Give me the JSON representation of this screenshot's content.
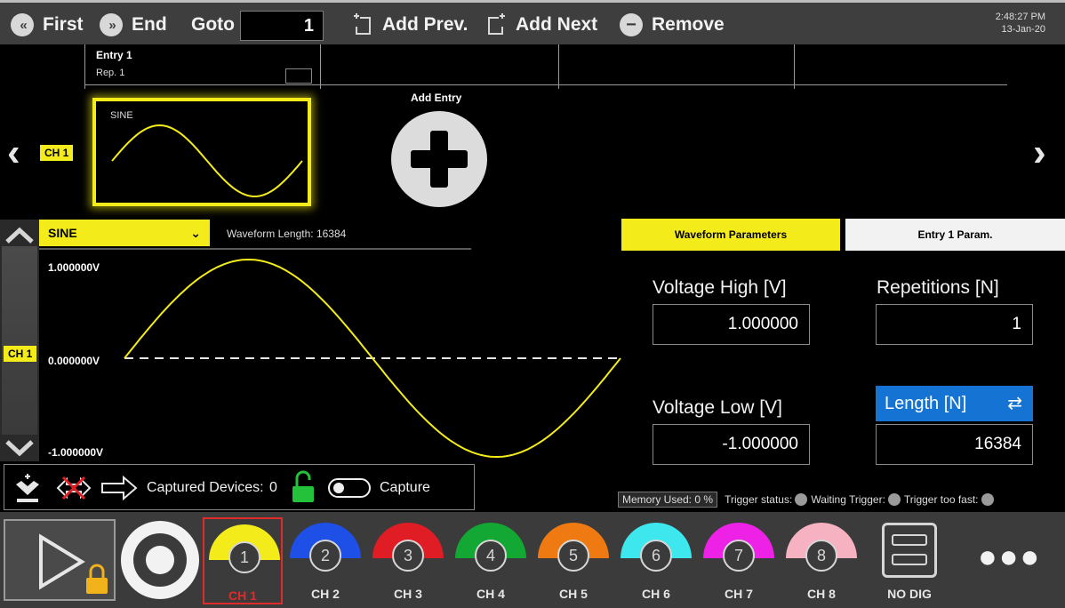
{
  "toolbar": {
    "first_label": "First",
    "end_label": "End",
    "goto_label": "Goto",
    "goto_value": "1",
    "add_prev_label": "Add Prev.",
    "add_next_label": "Add Next",
    "remove_label": "Remove",
    "clock_time": "2:48:27 PM",
    "clock_date": "13-Jan-20"
  },
  "sequence": {
    "entry_title": "Entry  1",
    "entry_rep": "Rep.  1",
    "card_label": "SINE",
    "channel_badge": "CH 1",
    "add_entry_label": "Add Entry"
  },
  "editor": {
    "waveform_type": "SINE",
    "waveform_length_label": "Waveform Length:",
    "waveform_length_value": "16384",
    "v_max_label": "1.000000V",
    "v_mid_label": "0.000000V",
    "v_min_label": "-1.000000V",
    "channel_badge": "CH 1",
    "waveform_color": "#f4ec1a"
  },
  "params": {
    "tab_waveform": "Waveform Parameters",
    "tab_entry": "Entry  1  Param.",
    "voltage_high_label": "Voltage High [V]",
    "voltage_high_value": "1.000000",
    "voltage_low_label": "Voltage Low [V]",
    "voltage_low_value": "-1.000000",
    "repetitions_label": "Repetitions [N]",
    "repetitions_value": "1",
    "length_label": "Length [N]",
    "length_value": "16384"
  },
  "capture": {
    "captured_devices_label": "Captured Devices:",
    "captured_devices_value": "0",
    "capture_label": "Capture"
  },
  "status": {
    "memory_label": "Memory Used:",
    "memory_value": "0 %",
    "trigger_status_label": "Trigger status:",
    "waiting_trigger_label": "Waiting Trigger:",
    "trigger_too_fast_label": "Trigger too fast:"
  },
  "channels": [
    {
      "num": "1",
      "name": "CH 1",
      "color": "#f4ec1a"
    },
    {
      "num": "2",
      "name": "CH 2",
      "color": "#1e4fe6"
    },
    {
      "num": "3",
      "name": "CH 3",
      "color": "#e01c24"
    },
    {
      "num": "4",
      "name": "CH 4",
      "color": "#12a833"
    },
    {
      "num": "5",
      "name": "CH 5",
      "color": "#f07a12"
    },
    {
      "num": "6",
      "name": "CH 6",
      "color": "#3ee6ee"
    },
    {
      "num": "7",
      "name": "CH 7",
      "color": "#ee22e6"
    },
    {
      "num": "8",
      "name": "CH 8",
      "color": "#f6b2c0"
    }
  ],
  "no_dig_label": "NO DIG"
}
